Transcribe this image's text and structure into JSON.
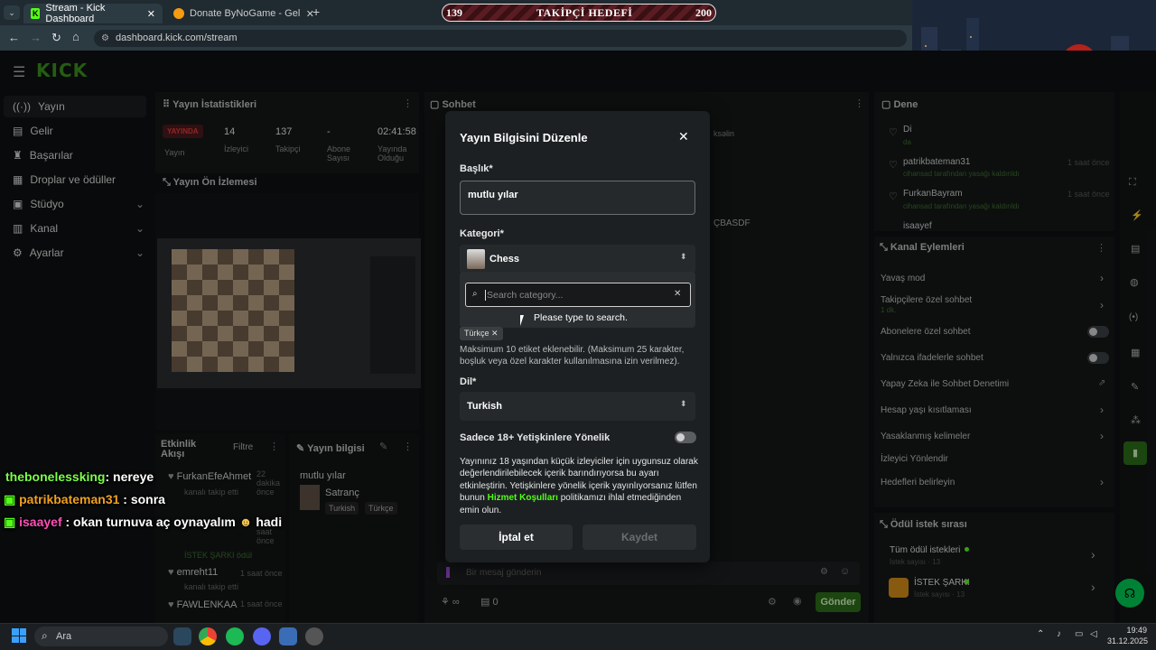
{
  "browser": {
    "tabs": [
      {
        "label": "Stream - Kick Dashboard"
      },
      {
        "label": "Donate ByNoGame - Gelen/Gid"
      }
    ],
    "url": "dashboard.kick.com/stream"
  },
  "goal": {
    "current": "139",
    "label": "TAKİPÇİ HEDEFİ",
    "target": "200",
    "progress": 0.695
  },
  "sidebar": {
    "logo": "KICK",
    "items": [
      {
        "label": "Yayın"
      },
      {
        "label": "Gelir"
      },
      {
        "label": "Başarılar"
      },
      {
        "label": "Droplar ve ödüller"
      },
      {
        "label": "Stüdyo"
      },
      {
        "label": "Kanal"
      },
      {
        "label": "Ayarlar"
      }
    ]
  },
  "stats": {
    "title": "Yayın İstatistikleri",
    "live_badge": "YAYINDA",
    "live_label": "Yayın",
    "viewers": "14",
    "viewers_label": "İzleyici",
    "followers": "137",
    "followers_label": "Takipçi",
    "subs": "-",
    "subs_label": "Abone Sayısı",
    "uptime": "02:41:58",
    "uptime_label": "Yayında Olduğu"
  },
  "preview": {
    "title": "Yayın Ön İzlemesi"
  },
  "activity": {
    "title": "Etkinlik Akışı",
    "filter": "Filtre",
    "items": [
      {
        "name": "FurkanEfeAhmet",
        "sub": "kanalı takip etti",
        "time": "22 dakika önce"
      },
      {
        "name": "patrikbateman31",
        "sub": "İSTEK ŞARKI ödül",
        "time": "saat önce"
      },
      {
        "name": "emreht11",
        "sub": "kanalı takip etti",
        "time": "1 saat önce"
      },
      {
        "name": "FAWLENKAA",
        "sub": "",
        "time": "1 saat önce"
      }
    ]
  },
  "stream_info": {
    "title": "Yayın bilgisi",
    "stream_title": "mutlu yılar",
    "category": "Satranç",
    "tags": [
      "Turkish",
      "Türkçe"
    ]
  },
  "chat": {
    "title": "Sohbet",
    "placeholder": "Bir mesaj gönderin",
    "send": "Gönder",
    "count": "0",
    "fragments": {
      "a": "ksəlin",
      "b": "ÇBASDF"
    }
  },
  "modal": {
    "title": "Yayın Bilgisini Düzenle",
    "title_label": "Başlık*",
    "title_value": "mutlu yılar",
    "category_label": "Kategori*",
    "category_value": "Chess",
    "search_placeholder": "Search category...",
    "search_hint": "Please type to search.",
    "tag": "Türkçe",
    "tag_help": "Maksimum 10 etiket eklenebilir. (Maksimum 25 karakter, boşluk veya özel karakter kullanılmasına izin verilmez).",
    "language_label": "Dil*",
    "language_value": "Turkish",
    "adult_label": "Sadece 18+ Yetişkinlere Yönelik",
    "adult_text_1": "Yayınınız 18 yaşından küçük izleyiciler için uygunsuz olarak değerlendirilebilecek içerik barındırıyorsa bu ayarı etkinleştirin. Yetişkinlere yönelik içerik yayınlıyorsanız lütfen bunun",
    "adult_link": "Hizmet Koşulları",
    "adult_text_2": "politikamızı ihlal etmediğinden emin olun.",
    "cancel": "İptal et",
    "save": "Kaydet"
  },
  "right": {
    "mods_title": "Dene",
    "mod_log": [
      {
        "name": "Di",
        "sub": "da"
      },
      {
        "name": "patrikbateman31",
        "sub": "cihansad tarafından yasağı kaldırıldı",
        "time": "1 saat önce"
      },
      {
        "name": "FurkanBayram",
        "sub": "cihansad tarafından yasağı kaldırıldı",
        "time": "1 saat önce"
      },
      {
        "name": "isaayef",
        "sub": "",
        "time": ""
      }
    ],
    "actions_title": "Kanal Eylemleri",
    "actions": [
      {
        "label": "Yavaş mod"
      },
      {
        "label": "Takipçilere özel sohbet",
        "sub": "1 dk."
      },
      {
        "label": "Abonelere özel sohbet"
      },
      {
        "label": "Yalnızca ifadelerle sohbet"
      },
      {
        "label": "Yapay Zeka ile Sohbet Denetimi"
      },
      {
        "label": "Hesap yaşı kısıtlaması"
      },
      {
        "label": "Yasaklanmış kelimeler"
      },
      {
        "label": "İzleyici Yönlendir"
      },
      {
        "label": "Hedefleri belirleyin"
      }
    ],
    "rewards_title": "Ödül istek sırası",
    "rewards": [
      {
        "label": "Tüm ödül istekleri",
        "sub": "İstek sayısı · 13"
      },
      {
        "label": "İSTEK ŞARKI",
        "sub": "İstek sayısı · 13"
      }
    ]
  },
  "overlay_chat": [
    {
      "user": "thebonelessking",
      "msg": ": nereye",
      "color": "#7dff4a"
    },
    {
      "user": "patrikbateman31",
      "msg": ": sonra",
      "color": "#f0a020"
    },
    {
      "user": "isaayef",
      "msg": ": okan turnuva aç oynayalım",
      "extra": "hadi",
      "color": "#ff4fb8"
    }
  ],
  "taskbar": {
    "search": "Ara",
    "time": "19:49",
    "date": "31.12.2025"
  },
  "colors": {
    "kick_green": "#53fc18",
    "live_red": "#e03a3a",
    "modal_bg": "#1c2023"
  }
}
